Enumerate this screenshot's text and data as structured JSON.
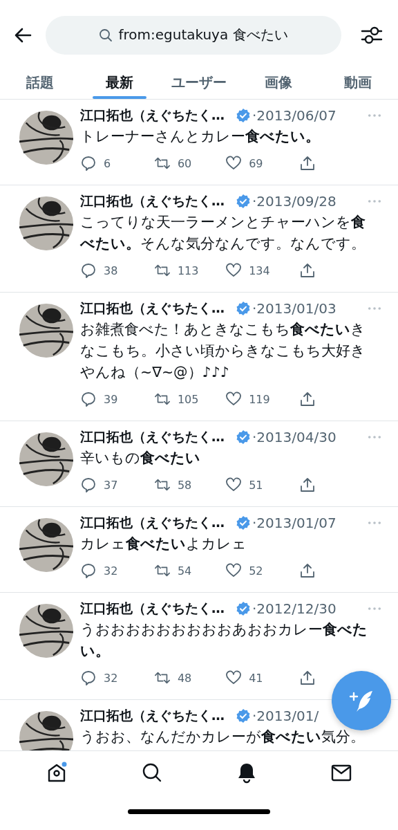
{
  "search": {
    "value": "from:egutakuya 食べたい"
  },
  "tabs": [
    {
      "label": "話題",
      "selected": false
    },
    {
      "label": "最新",
      "selected": true
    },
    {
      "label": "ユーザー",
      "selected": false
    },
    {
      "label": "画像",
      "selected": false
    },
    {
      "label": "動画",
      "selected": false
    }
  ],
  "tweets": [
    {
      "name": "江口拓也（えぐちたく…",
      "verified": true,
      "date": "·2013/06/07",
      "more": true,
      "text": "トレーナーさんとカレー**食べたい。**",
      "replies": "6",
      "retweets": "60",
      "likes": "69"
    },
    {
      "name": "江口拓也（えぐちたく…",
      "verified": true,
      "date": "·2013/09/28",
      "more": true,
      "text": "こってりな天一ラーメンとチャーハンを**食べたい。**そんな気分なんです。なんです。",
      "replies": "38",
      "retweets": "113",
      "likes": "134"
    },
    {
      "name": "江口拓也（えぐちたく…",
      "verified": true,
      "date": "·2013/01/03",
      "more": true,
      "text": "お雑煮食べた！あときなこもち**食べたい**きなこもち。小さい頃からきなこもち大好きやんね（~∇~@）♪♪♪",
      "replies": "39",
      "retweets": "105",
      "likes": "119"
    },
    {
      "name": "江口拓也（えぐちたく…",
      "verified": true,
      "date": "·2013/04/30",
      "more": true,
      "text": "辛いもの**食べたい**",
      "replies": "37",
      "retweets": "58",
      "likes": "51"
    },
    {
      "name": "江口拓也（えぐちたく…",
      "verified": true,
      "date": "·2013/01/07",
      "more": true,
      "text": "カレェ**食べたい**よカレェ",
      "replies": "32",
      "retweets": "54",
      "likes": "52"
    },
    {
      "name": "江口拓也（えぐちたく…",
      "verified": true,
      "date": "·2012/12/30",
      "more": true,
      "text": "うおおおおおおおおおあおおカレー**食べたい。**",
      "replies": "32",
      "retweets": "48",
      "likes": "41"
    },
    {
      "name": "江口拓也（えぐちたく…",
      "verified": true,
      "date": "·2013/01/",
      "text": "うおお、なんだかカレーが**食べたい**気分。"
    }
  ]
}
